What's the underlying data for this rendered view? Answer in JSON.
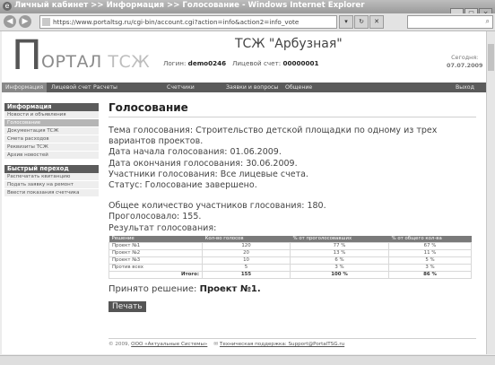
{
  "window": {
    "title": "Личный кабинет >> Информация >> Голосование - Windows Internet Explorer",
    "url": "https://www.portaltsg.ru/cgi-bin/account.cgi?action=info&action2=info_vote"
  },
  "header": {
    "logo_p": "П",
    "logo_portal": "ОРТАЛ",
    "logo_tsj": "ТСЖ",
    "tsj_name": "ТСЖ \"Арбузная\"",
    "login_label": "Логин:",
    "login_value": "demo0246",
    "account_label": "Лицевой счет:",
    "account_value": "00000001",
    "today_label": "Сегодня:",
    "today_date": "07.07.2009"
  },
  "menu": {
    "items": [
      "Информация",
      "Лицевой счет",
      "Расчеты",
      "Счетчики",
      "Заявки и вопросы",
      "Общение"
    ],
    "logout": "Выход"
  },
  "sidebar": {
    "info_title": "Информация",
    "info_items": [
      "Новости и объявления",
      "Голосование",
      "Документация ТСЖ",
      "Смета расходов",
      "Реквизиты ТСЖ",
      "Архив новостей"
    ],
    "quick_title": "Быстрый переход",
    "quick_items": [
      "Распечатать квитанцию",
      "Подать заявку на ремонт",
      "Ввести показания счетчика"
    ]
  },
  "main": {
    "title": "Голосование",
    "topic": "Тема голосования: Строительство детской площадки по одному из трех вариантов проектов.",
    "start": "Дата начала голосования: 01.06.2009.",
    "end": "Дата окончания голосования: 30.06.2009.",
    "participants": "Участники голосования: Все лицевые счета.",
    "status": "Статус: Голосование завершено.",
    "total": "Общее количество участников глосования: 180.",
    "voted": "Проголосовало: 155.",
    "result_label": "Результат голосования:",
    "table": {
      "headers": [
        "Решение",
        "Кол-во голосов",
        "% от проголосовавших",
        "% от общего кол-ва"
      ],
      "rows": [
        [
          "Проект №1",
          "120",
          "77 %",
          "67 %"
        ],
        [
          "Проект №2",
          "20",
          "13 %",
          "11 %"
        ],
        [
          "Проект №3",
          "10",
          "6 %",
          "5 %"
        ],
        [
          "Против всех",
          "5",
          "3 %",
          "3 %"
        ]
      ],
      "total_row": [
        "Итого:",
        "155",
        "100 %",
        "86 %"
      ]
    },
    "decision_label": "Принято решение:",
    "decision_value": "Проект №1.",
    "print_button": "Печать"
  },
  "footer": {
    "copyright": "© 2009,",
    "company": "ООО «Актуальные Системы»",
    "support": "Техническая поддержка: Support@PortalTSG.ru"
  }
}
